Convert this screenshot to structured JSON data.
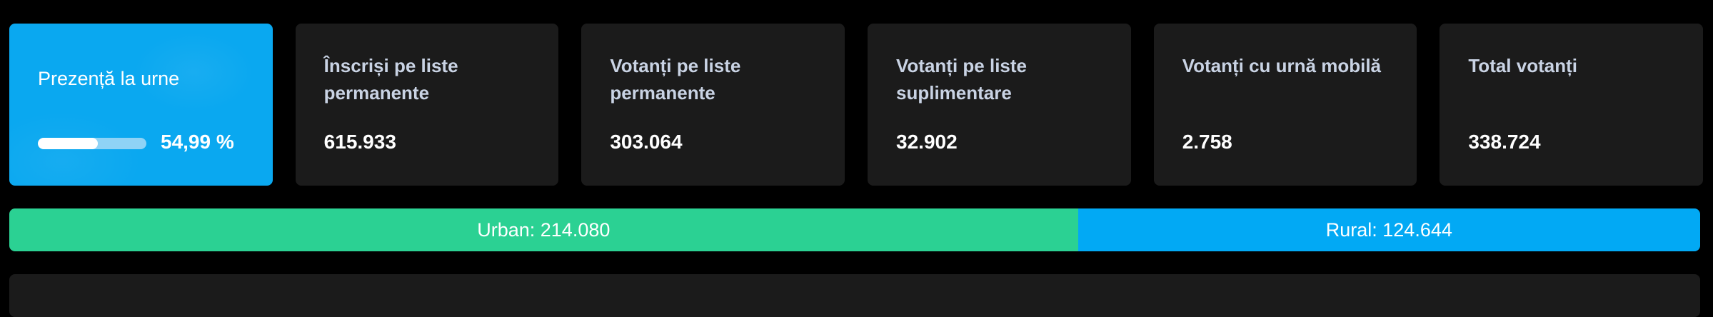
{
  "summary": {
    "presence": {
      "label": "Prezență la urne",
      "percent_text": "54,99 %",
      "percent_value": 0.5499,
      "bar_fill_color": "#ffffff",
      "bar_track_color": "#8fd3f6",
      "card_color": "#0aa8f0"
    },
    "cards": [
      {
        "label": "Înscriși pe liste permanente",
        "value": "615.933"
      },
      {
        "label": "Votanți pe liste permanente",
        "value": "303.064"
      },
      {
        "label": "Votanți pe liste suplimentare",
        "value": "32.902"
      },
      {
        "label": "Votanți cu urnă mobilă",
        "value": "2.758"
      },
      {
        "label": "Total votanți",
        "value": "338.724"
      }
    ]
  },
  "split": {
    "urban": {
      "label": "Urban: 214.080",
      "value": 214080,
      "color": "#2bd193"
    },
    "rural": {
      "label": "Rural: 124.644",
      "value": 124644,
      "color": "#02a9f4"
    }
  }
}
